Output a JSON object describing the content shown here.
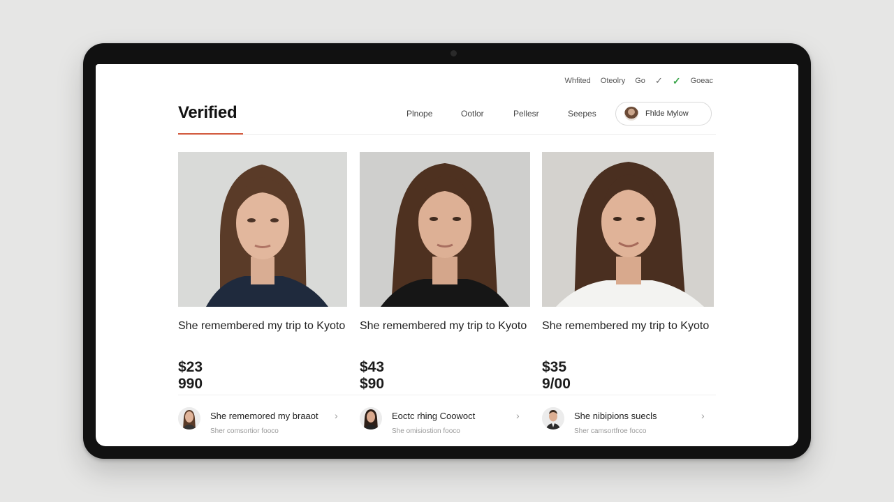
{
  "topbar": {
    "items": [
      "Whfited",
      "Oteolry",
      "Go"
    ],
    "check_icon": "check-icon",
    "verified_icon": "green-check-icon",
    "verified_color": "#3aa54a",
    "last": "Goeac"
  },
  "brand": {
    "name": "Verified",
    "accent": "#d2593c"
  },
  "nav": {
    "items": [
      "Plnope",
      "Ootlor",
      "Pellesr",
      "Seepes"
    ]
  },
  "profile": {
    "label": "Fhlde Mylow"
  },
  "cards": [
    {
      "title": "She remembered my trip to Kyoto",
      "price": "$23 990"
    },
    {
      "title": "She remembered my trip to Kyoto",
      "price": "$43 $90"
    },
    {
      "title": "She remembered my trip to Kyoto",
      "price": "$35 9/00"
    }
  ],
  "list": [
    {
      "title": "She rememored my braaot",
      "subtitle": "Sher comsortior fooco"
    },
    {
      "title": "Eoctc rhing Coowoct",
      "subtitle": "She omisiostion fooco"
    },
    {
      "title": "She nibipions suecls",
      "subtitle": "Sher camsortfroe focco"
    }
  ],
  "chevron_icon": "›"
}
